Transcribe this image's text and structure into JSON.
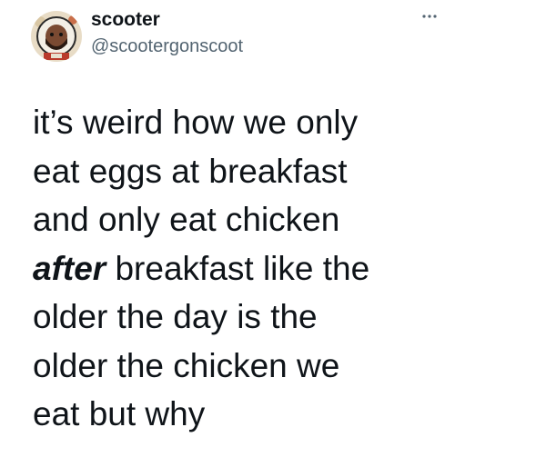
{
  "user": {
    "display_name": "scooter",
    "handle": "@scootergonscoot",
    "avatar_icon": "astronaut-avatar-icon"
  },
  "menu": {
    "more_icon": "more-horizontal-icon"
  },
  "tweet": {
    "line1": "it’s weird how we only",
    "line2": "eat eggs at breakfast",
    "line3": "and only eat chicken",
    "line4_emphasis": "after",
    "line4_rest": " breakfast like the",
    "line5": "older the day is the",
    "line6": "older the chicken we",
    "line7": "eat but why"
  },
  "colors": {
    "text": "#0f1419",
    "secondary_text": "#536471",
    "background": "#ffffff"
  }
}
